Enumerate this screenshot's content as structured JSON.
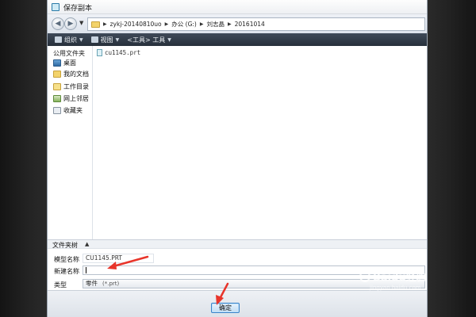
{
  "window": {
    "title": "保存副本"
  },
  "address": {
    "crumbs": [
      "zykj-20140810uo",
      "办公 (G:)",
      "刘志晶",
      "20161014"
    ]
  },
  "toolbar": {
    "organize_label": "组织",
    "view_label": "视图",
    "tools_label": "<工具> 工具"
  },
  "sidebar": {
    "heading": "公用文件夹",
    "items": [
      {
        "label": "桌面",
        "icon": "desktop-icon"
      },
      {
        "label": "我的文档",
        "icon": "documents-icon"
      },
      {
        "label": "工作目录",
        "icon": "work-folder-icon"
      },
      {
        "label": "网上邻居",
        "icon": "network-icon"
      },
      {
        "label": "收藏夹",
        "icon": "favorites-icon"
      }
    ]
  },
  "files": [
    {
      "name": "cu1145.prt",
      "icon": "part-file-icon"
    }
  ],
  "collapse": {
    "label": "文件夹树",
    "chevron": "▲"
  },
  "form": {
    "model_name_label": "模型名称",
    "model_name_value": "CU1145.PRT",
    "new_name_label": "新建名称",
    "new_name_value": "",
    "type_label": "类型",
    "type_value": "零件",
    "type_hint": "(*.prt)"
  },
  "buttons": {
    "ok_label": "确定"
  },
  "watermark": {
    "brand": "Baidu经验",
    "url": "jingyan.baidu.com"
  },
  "colors": {
    "toolbar_bg": "#27303b",
    "annotation_arrow": "#e8352b",
    "ok_button_border": "#3a83c7"
  }
}
